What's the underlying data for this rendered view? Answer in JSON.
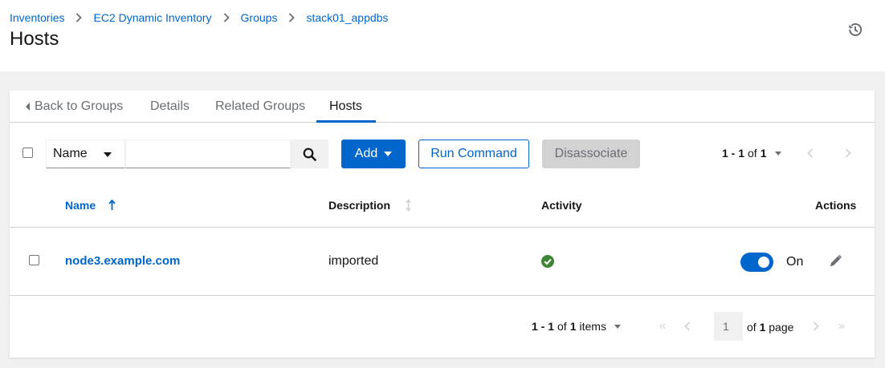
{
  "breadcrumb": [
    "Inventories",
    "EC2 Dynamic Inventory",
    "Groups",
    "stack01_appdbs"
  ],
  "page_title": "Hosts",
  "tabs": {
    "back": "Back to Groups",
    "details": "Details",
    "related_groups": "Related Groups",
    "hosts": "Hosts"
  },
  "toolbar": {
    "filter_select": "Name",
    "search_placeholder": "",
    "add_label": "Add",
    "run_command_label": "Run Command",
    "disassociate_label": "Disassociate",
    "pagination_bold": "1 - 1",
    "pagination_of": "of",
    "pagination_total": "1"
  },
  "table": {
    "columns": {
      "name": "Name",
      "description": "Description",
      "activity": "Activity",
      "actions": "Actions"
    },
    "rows": [
      {
        "name": "node3.example.com",
        "description": "imported",
        "activity_status": "success",
        "enabled_label": "On"
      }
    ]
  },
  "pagination": {
    "range": "1 - 1",
    "of": "of",
    "total": "1",
    "items": "items",
    "page_value": "1",
    "of_pages": "of",
    "pages_total": "1",
    "page_word": "page"
  },
  "colors": {
    "primary": "#0066cc",
    "success": "#3e8635",
    "disabled": "#d2d2d2"
  }
}
